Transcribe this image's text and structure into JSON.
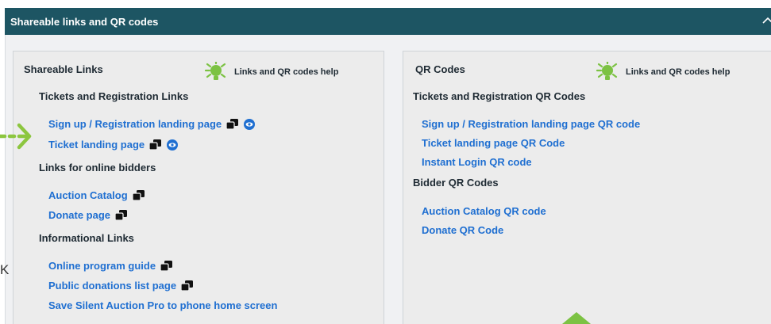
{
  "header": {
    "title": "Shareable links and QR codes",
    "collapse_icon": "chevron-up-icon"
  },
  "colors": {
    "header_bg": "#1d5563",
    "link": "#1f6fd1",
    "accent": "#7cc243"
  },
  "stray_text": "K",
  "links_panel": {
    "title": "Shareable Links",
    "help_label": "Links and QR codes help",
    "sections": [
      {
        "title": "Tickets and Registration Links",
        "items": [
          {
            "label": "Sign up / Registration landing page",
            "icons": [
              "copy-icon",
              "eye-icon"
            ]
          },
          {
            "label": "Ticket landing page",
            "icons": [
              "copy-icon",
              "eye-icon"
            ]
          }
        ]
      },
      {
        "title": "Links for online bidders",
        "items": [
          {
            "label": "Auction Catalog",
            "icons": [
              "copy-icon"
            ]
          },
          {
            "label": "Donate page",
            "icons": [
              "copy-icon"
            ]
          }
        ]
      },
      {
        "title": "Informational Links",
        "items": [
          {
            "label": "Online program guide",
            "icons": [
              "copy-icon"
            ]
          },
          {
            "label": "Public donations list page",
            "icons": [
              "copy-icon"
            ]
          },
          {
            "label": "Save Silent Auction Pro to phone home screen",
            "icons": []
          }
        ]
      }
    ]
  },
  "qr_panel": {
    "title": "QR Codes",
    "help_label": "Links and QR codes help",
    "sections": [
      {
        "title": "Tickets and Registration QR Codes",
        "items": [
          {
            "label": "Sign up / Registration landing page QR code"
          },
          {
            "label": "Ticket landing page QR Code"
          },
          {
            "label": "Instant Login QR code"
          }
        ]
      },
      {
        "title": "Bidder QR Codes",
        "items": [
          {
            "label": "Auction Catalog QR code"
          },
          {
            "label": "Donate QR Code"
          }
        ]
      }
    ]
  }
}
